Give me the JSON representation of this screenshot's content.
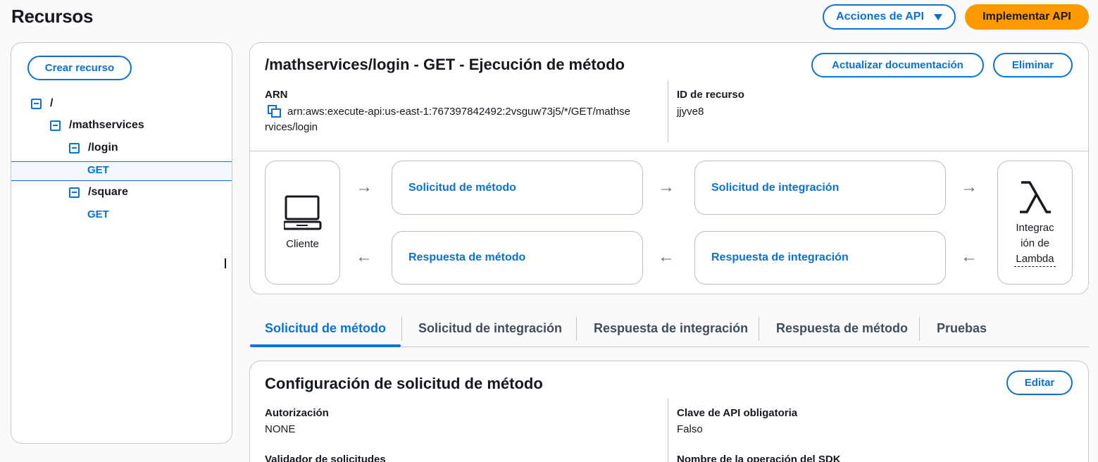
{
  "header": {
    "title": "Recursos",
    "actions_label": "Acciones de API",
    "deploy_label": "Implementar API"
  },
  "tree": {
    "create_label": "Crear recurso",
    "root": "/",
    "mathservices": "/mathservices",
    "login": "/login",
    "login_get": "GET",
    "square": "/square",
    "square_get": "GET"
  },
  "method": {
    "title": "/mathservices/login - GET - Ejecución de método",
    "update_docs_label": "Actualizar documentación",
    "delete_label": "Eliminar",
    "arn_label": "ARN",
    "arn_line1": "arn:aws:execute-api:us-east-1:767397842492:2vsguw73j5/*/GET/mathse",
    "arn_line2": "rvices/login",
    "resource_id_label": "ID de recurso",
    "resource_id": "jjyve8"
  },
  "flow": {
    "client_label": "Cliente",
    "method_request": "Solicitud de método",
    "integration_request": "Solicitud de integración",
    "method_response": "Respuesta de método",
    "integration_response": "Respuesta de integración",
    "lambda_line1": "Integrac",
    "lambda_line2": "ión de",
    "lambda_line3": "Lambda"
  },
  "tabs": [
    {
      "label": "Solicitud de método",
      "active": true
    },
    {
      "label": "Solicitud de integración",
      "active": false
    },
    {
      "label": "Respuesta de integración",
      "active": false
    },
    {
      "label": "Respuesta de método",
      "active": false
    },
    {
      "label": "Pruebas",
      "active": false
    }
  ],
  "config": {
    "title": "Configuración de solicitud de método",
    "edit_label": "Editar",
    "auth_label": "Autorización",
    "auth_value": "NONE",
    "api_key_label": "Clave de API obligatoria",
    "api_key_value": "Falso",
    "validator_label": "Validador de solicitudes",
    "sdk_label": "Nombre de la operación del SDK"
  },
  "colors": {
    "accent": "#0972d3",
    "primary": "#ff9900",
    "text": "#16191f",
    "border": "#c6c6cd"
  }
}
